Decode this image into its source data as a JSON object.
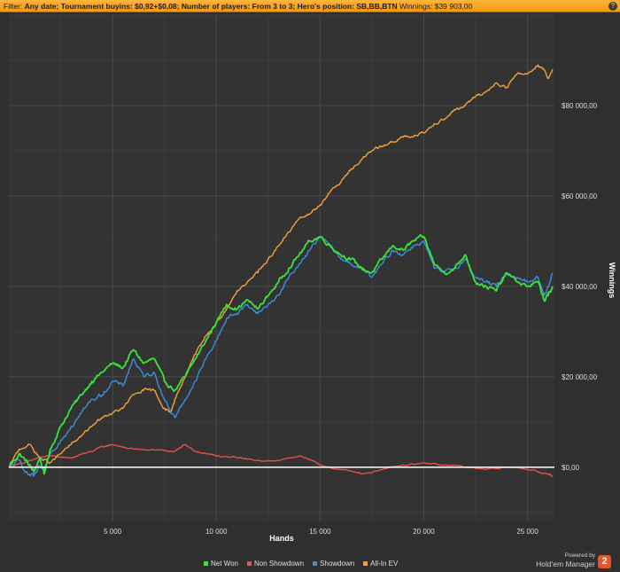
{
  "filter": {
    "prefix": "Filter: ",
    "criteria": "Any date; Tournament buyins: $0,92+$0,08; Number of players: From 3 to 3; Hero's position: SB,BB,BTN",
    "winnings_label": " Winnings: $39 903,00",
    "help_icon": "?"
  },
  "footer": {
    "powered_by": "Powered by",
    "brand": "Hold'em Manager",
    "logo_mark": "2"
  },
  "colors": {
    "background": "#2f2f2f",
    "grid": "#4a4a4a",
    "zero_line": "#ffffff",
    "net_won": "#39e63a",
    "non_showdown": "#e8504a",
    "showdown": "#3d8ee0",
    "all_in_ev": "#f5a03a"
  },
  "chart_data": {
    "type": "line",
    "title": "",
    "xlabel": "Hands",
    "ylabel": "Winnings",
    "xlim": [
      0,
      26300
    ],
    "ylim": [
      -12000,
      100000
    ],
    "x_ticks": [
      5000,
      10000,
      15000,
      20000,
      25000
    ],
    "x_tick_labels": [
      "5 000",
      "10 000",
      "15 000",
      "20 000",
      "25 000"
    ],
    "y_ticks": [
      0,
      20000,
      40000,
      60000,
      80000
    ],
    "y_tick_labels": [
      "$0,00",
      "$20 000,00",
      "$40 000,00",
      "$60 000,00",
      "$80 000,00"
    ],
    "y_axis_side": "right",
    "grid": true,
    "legend_position": "bottom",
    "series": [
      {
        "name": "Net Won",
        "color": "#39e63a",
        "x": [
          0,
          500,
          900,
          1200,
          1500,
          1700,
          2000,
          2500,
          3000,
          3500,
          4000,
          4500,
          5000,
          5500,
          6000,
          6500,
          7000,
          7500,
          8000,
          8500,
          9000,
          9500,
          10000,
          10500,
          11000,
          11500,
          12000,
          12500,
          13000,
          13500,
          14000,
          14500,
          15000,
          15500,
          16000,
          16500,
          17000,
          17500,
          18000,
          18500,
          19000,
          19500,
          20000,
          20500,
          21000,
          21500,
          22000,
          22500,
          23000,
          23500,
          24000,
          24500,
          25000,
          25500,
          25800,
          26000,
          26200
        ],
        "values": [
          0,
          3000,
          1000,
          -1000,
          2000,
          -1500,
          4000,
          9000,
          13000,
          16000,
          19000,
          21000,
          23000,
          22000,
          26000,
          23000,
          24000,
          19000,
          17000,
          20000,
          24000,
          28000,
          32000,
          36000,
          35000,
          37000,
          35000,
          38000,
          41000,
          44000,
          47000,
          50000,
          51000,
          49000,
          47000,
          46000,
          44000,
          43000,
          46000,
          49000,
          48000,
          50000,
          51000,
          45000,
          43000,
          44000,
          47000,
          41000,
          40000,
          39000,
          43000,
          41000,
          40000,
          41000,
          37000,
          38000,
          40000
        ]
      },
      {
        "name": "Non Showdown",
        "color": "#e8504a",
        "x": [
          0,
          1000,
          2000,
          3000,
          4000,
          4500,
          5000,
          6000,
          7000,
          8000,
          8500,
          9000,
          10000,
          11000,
          12000,
          13000,
          14000,
          15000,
          16000,
          17000,
          18000,
          19000,
          20000,
          21000,
          22000,
          23000,
          24000,
          25000,
          26000,
          26200
        ],
        "values": [
          0,
          1500,
          2500,
          2000,
          3500,
          4500,
          5000,
          4000,
          3800,
          3500,
          5000,
          3500,
          2500,
          2000,
          1500,
          1500,
          2500,
          500,
          -500,
          -1500,
          -500,
          500,
          1000,
          500,
          0,
          -500,
          0,
          -500,
          -1500,
          -2000
        ]
      },
      {
        "name": "Showdown",
        "color": "#3d8ee0",
        "x": [
          0,
          500,
          900,
          1200,
          1500,
          1700,
          2000,
          2500,
          3000,
          3500,
          4000,
          4500,
          5000,
          5500,
          6000,
          6500,
          7000,
          7500,
          8000,
          8500,
          9000,
          9500,
          10000,
          10500,
          11000,
          11500,
          12000,
          12500,
          13000,
          13500,
          14000,
          14500,
          15000,
          15500,
          16000,
          16500,
          17000,
          17500,
          18000,
          18500,
          19000,
          19500,
          20000,
          20500,
          21000,
          21500,
          22000,
          22500,
          23000,
          23500,
          24000,
          24500,
          25000,
          25500,
          25800,
          26000,
          26200
        ],
        "values": [
          0,
          1500,
          -1500,
          -2000,
          0,
          -1000,
          3000,
          6000,
          9000,
          12000,
          15000,
          16000,
          19000,
          18000,
          24000,
          20000,
          21000,
          15000,
          11000,
          15000,
          19000,
          24000,
          28000,
          33000,
          34000,
          36000,
          34000,
          36000,
          38000,
          42000,
          45000,
          48000,
          51000,
          49000,
          46000,
          45000,
          44000,
          42000,
          45000,
          48000,
          47000,
          49000,
          50000,
          44000,
          43000,
          44000,
          46000,
          42000,
          41000,
          40000,
          43000,
          42000,
          41000,
          42000,
          38000,
          40000,
          43000
        ]
      },
      {
        "name": "All-In EV",
        "color": "#f5a03a",
        "x": [
          0,
          500,
          1000,
          1500,
          2000,
          2500,
          3000,
          3500,
          4000,
          4500,
          5000,
          5500,
          6000,
          6500,
          7000,
          7500,
          7800,
          8000,
          8500,
          9000,
          9500,
          10000,
          10500,
          11000,
          11500,
          12000,
          12500,
          13000,
          13500,
          14000,
          14500,
          15000,
          15500,
          16000,
          16500,
          17000,
          17500,
          18000,
          18500,
          19000,
          19500,
          20000,
          20500,
          21000,
          21500,
          22000,
          22500,
          23000,
          23500,
          24000,
          24500,
          25000,
          25500,
          25800,
          26000,
          26200
        ],
        "values": [
          0,
          4000,
          5000,
          2000,
          1000,
          3000,
          5000,
          7000,
          9000,
          11000,
          12000,
          13000,
          16000,
          17000,
          17000,
          13000,
          12000,
          15000,
          20000,
          25000,
          29000,
          32000,
          35000,
          39000,
          41000,
          43000,
          46000,
          49000,
          52000,
          55000,
          56000,
          58000,
          61000,
          63000,
          66000,
          68000,
          70000,
          71000,
          72000,
          73000,
          73000,
          74000,
          76000,
          77000,
          79000,
          80000,
          82000,
          83000,
          85000,
          84000,
          87000,
          87000,
          89000,
          88000,
          86000,
          88000
        ]
      }
    ]
  }
}
